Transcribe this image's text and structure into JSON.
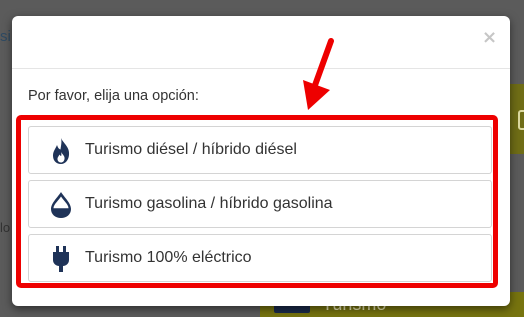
{
  "background": {
    "left_text_top": "si",
    "left_text_mid": "lo",
    "bottom_label": "Turismo",
    "overlay_color": "#5b5b5b",
    "accent_olive": "#77740f"
  },
  "modal": {
    "close_symbol": "×",
    "prompt": "Por favor, elija una opción:",
    "options": [
      {
        "label": "Turismo diésel / híbrido diésel",
        "icon": "flame-icon"
      },
      {
        "label": "Turismo gasolina / híbrido gasolina",
        "icon": "drop-icon"
      },
      {
        "label": "Turismo 100% eléctrico",
        "icon": "plug-icon"
      }
    ],
    "icon_color": "#1f3358",
    "highlight_color": "#ee0000"
  },
  "annotation": {
    "arrow_color": "#ee0000"
  }
}
